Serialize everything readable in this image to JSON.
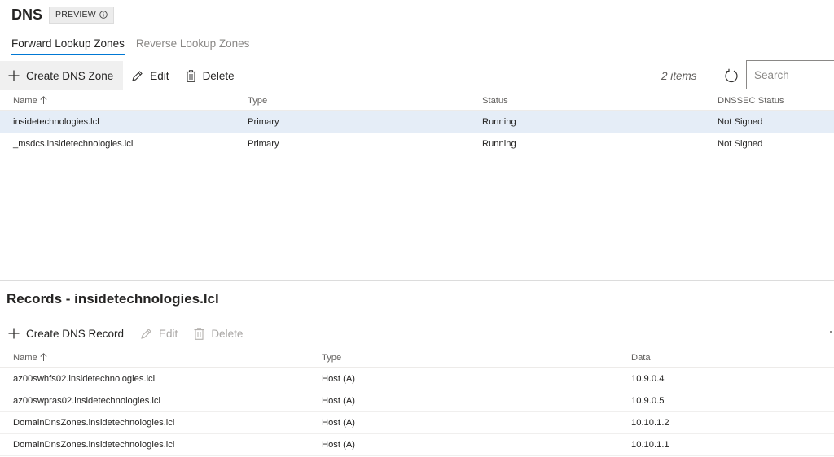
{
  "header": {
    "title": "DNS",
    "badge": "PREVIEW"
  },
  "tabs": [
    {
      "label": "Forward Lookup Zones",
      "active": true
    },
    {
      "label": "Reverse Lookup Zones",
      "active": false
    }
  ],
  "zones_toolbar": {
    "create_label": "Create DNS Zone",
    "edit_label": "Edit",
    "delete_label": "Delete",
    "items_count": "2 items",
    "search_placeholder": "Search"
  },
  "zones_grid": {
    "columns": [
      "Name",
      "Type",
      "Status",
      "DNSSEC Status"
    ],
    "rows": [
      {
        "name": "insidetechnologies.lcl",
        "type": "Primary",
        "status": "Running",
        "dnssec": "Not Signed",
        "selected": true
      },
      {
        "name": "_msdcs.insidetechnologies.lcl",
        "type": "Primary",
        "status": "Running",
        "dnssec": "Not Signed",
        "selected": false
      }
    ]
  },
  "records": {
    "title": "Records - insidetechnologies.lcl",
    "toolbar": {
      "create_label": "Create DNS Record",
      "edit_label": "Edit",
      "delete_label": "Delete"
    },
    "columns": [
      "Name",
      "Type",
      "Data"
    ],
    "rows": [
      {
        "name": "az00swhfs02.insidetechnologies.lcl",
        "type": "Host (A)",
        "data": "10.9.0.4"
      },
      {
        "name": "az00swpras02.insidetechnologies.lcl",
        "type": "Host (A)",
        "data": "10.9.0.5"
      },
      {
        "name": "DomainDnsZones.insidetechnologies.lcl",
        "type": "Host (A)",
        "data": "10.10.1.2"
      },
      {
        "name": "DomainDnsZones.insidetechnologies.lcl",
        "type": "Host (A)",
        "data": "10.10.1.1"
      }
    ]
  },
  "colors": {
    "accent": "#0078d4",
    "selected_row": "#e5edf7",
    "text": "#252423",
    "muted": "#605e5c"
  },
  "icons": [
    "info-icon",
    "plus-icon",
    "pencil-icon",
    "trash-icon",
    "refresh-icon",
    "sort-up-icon"
  ]
}
